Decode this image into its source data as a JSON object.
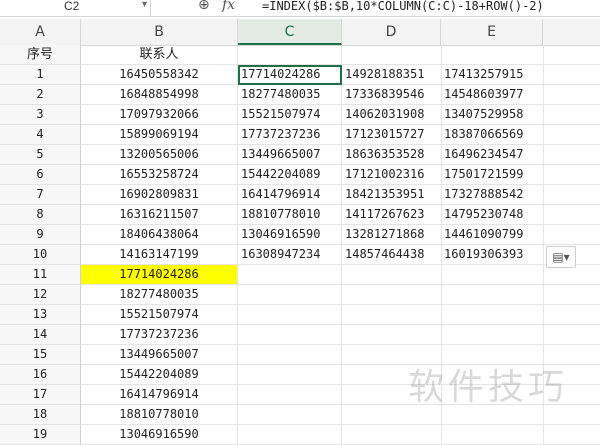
{
  "formula_bar": {
    "name_box": "C2",
    "name_box_arrow": "▾",
    "zoom_glyph": "⊕",
    "fx_label": "fx",
    "formula": "=INDEX($B:$B,10*COLUMN(C:C)-18+ROW()-2)"
  },
  "columns": [
    {
      "letter": "A"
    },
    {
      "letter": "B"
    },
    {
      "letter": "C"
    },
    {
      "letter": "D"
    },
    {
      "letter": "E"
    }
  ],
  "header_row": {
    "row": "",
    "a": "序号",
    "b": "联系人"
  },
  "rows": [
    {
      "num": "1",
      "a": "1",
      "b": "16450558342",
      "c": "17714024286",
      "d": "14928188351",
      "e": "17413257915"
    },
    {
      "num": "2",
      "a": "2",
      "b": "16848854998",
      "c": "18277480035",
      "d": "17336839546",
      "e": "14548603977"
    },
    {
      "num": "3",
      "a": "3",
      "b": "17097932066",
      "c": "15521507974",
      "d": "14062031908",
      "e": "13407529958"
    },
    {
      "num": "4",
      "a": "4",
      "b": "15899069194",
      "c": "17737237236",
      "d": "17123015727",
      "e": "18387066569"
    },
    {
      "num": "5",
      "a": "5",
      "b": "13200565006",
      "c": "13449665007",
      "d": "18636353528",
      "e": "16496234547"
    },
    {
      "num": "6",
      "a": "6",
      "b": "16553258724",
      "c": "15442204089",
      "d": "17121002316",
      "e": "17501721599"
    },
    {
      "num": "7",
      "a": "7",
      "b": "16902809831",
      "c": "16414796914",
      "d": "18421353951",
      "e": "17327888542"
    },
    {
      "num": "8",
      "a": "8",
      "b": "16316211507",
      "c": "18810778010",
      "d": "14117267623",
      "e": "14795230748"
    },
    {
      "num": "9",
      "a": "9",
      "b": "18406438064",
      "c": "13046916590",
      "d": "13281271868",
      "e": "14461090799"
    },
    {
      "num": "10",
      "a": "10",
      "b": "14163147199",
      "c": "16308947234",
      "d": "14857464438",
      "e": "16019306393"
    },
    {
      "num": "11",
      "a": "11",
      "b": "17714024286",
      "c": "",
      "d": "",
      "e": ""
    },
    {
      "num": "12",
      "a": "12",
      "b": "18277480035",
      "c": "",
      "d": "",
      "e": ""
    },
    {
      "num": "13",
      "a": "13",
      "b": "15521507974",
      "c": "",
      "d": "",
      "e": ""
    },
    {
      "num": "14",
      "a": "14",
      "b": "17737237236",
      "c": "",
      "d": "",
      "e": ""
    },
    {
      "num": "15",
      "a": "15",
      "b": "13449665007",
      "c": "",
      "d": "",
      "e": ""
    },
    {
      "num": "16",
      "a": "16",
      "b": "15442204089",
      "c": "",
      "d": "",
      "e": ""
    },
    {
      "num": "17",
      "a": "17",
      "b": "16414796914",
      "c": "",
      "d": "",
      "e": ""
    },
    {
      "num": "18",
      "a": "18",
      "b": "18810778010",
      "c": "",
      "d": "",
      "e": ""
    },
    {
      "num": "19",
      "a": "19",
      "b": "13046916590",
      "c": "",
      "d": "",
      "e": ""
    }
  ],
  "active_cell": "C2",
  "highlighted_cell": "B12",
  "colors": {
    "accent": "#1e7145",
    "highlight": "#ffff00"
  },
  "paste_options_glyph": "▤▾",
  "watermark": "软件技巧"
}
